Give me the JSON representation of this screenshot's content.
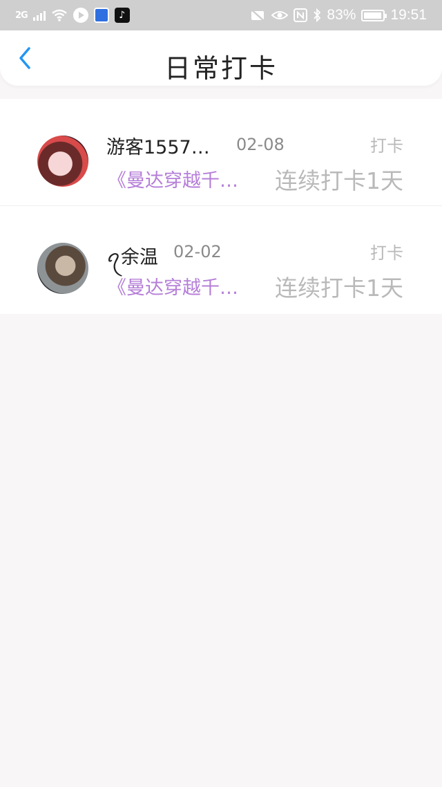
{
  "status_bar": {
    "signal_label": "2G",
    "battery": "83%",
    "battery_level": 0.83,
    "time": "19:51"
  },
  "header": {
    "title": "日常打卡",
    "back_icon": "chevron-left-icon",
    "accent_color": "#2196f3"
  },
  "records": [
    {
      "user": "游客1557…",
      "date": "02-08",
      "tag": "打卡",
      "book": "《曼达穿越千…",
      "streak": "连续打卡1天"
    },
    {
      "user": "ꪖ余温",
      "date": "02-02",
      "tag": "打卡",
      "book": "《曼达穿越千…",
      "streak": "连续打卡1天"
    }
  ],
  "colors": {
    "book_title": "#b57ed8",
    "muted": "#b9b9b9",
    "background": "#f8f6f7"
  }
}
